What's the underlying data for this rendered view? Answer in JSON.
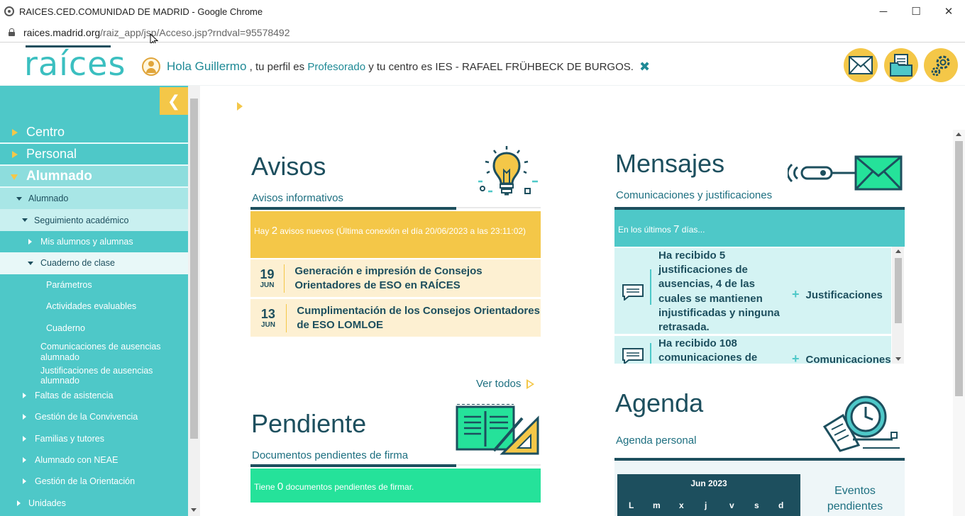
{
  "browser": {
    "window_title": "RAICES.CED.COMUNIDAD DE MADRID - Google Chrome",
    "url_host": "raices.madrid.org",
    "url_path": "/raiz_app/jsp/Acceso.jsp?rndval=95578492",
    "minimize": "─",
    "maximize": "☐",
    "close": "✕"
  },
  "header": {
    "logo": "raíces",
    "greeting_hola": "Hola Guillermo",
    "greeting_mid": ", tu perfil es",
    "perfil": "Profesorado",
    "greeting_centro": "y tu centro es IES - RAFAEL FRÜHBECK DE BURGOS.",
    "close_glyph": "✖",
    "buttons": [
      "mail-icon",
      "documents-icon",
      "settings-icon"
    ]
  },
  "sidebar": {
    "collapse_glyph": "❮",
    "items": [
      {
        "label": "Centro"
      },
      {
        "label": "Personal"
      },
      {
        "label": "Alumnado"
      },
      {
        "label": "Alumnado"
      },
      {
        "label": "Seguimiento académico"
      },
      {
        "label": "Mis alumnos y alumnas"
      },
      {
        "label": "Cuaderno de clase"
      },
      {
        "label": "Parámetros"
      },
      {
        "label": "Actividades evaluables"
      },
      {
        "label": "Cuaderno"
      },
      {
        "label": "Comunicaciones de ausencias alumnado"
      },
      {
        "label": "Justificaciones de ausencias alumnado"
      },
      {
        "label": "Faltas de asistencia"
      },
      {
        "label": "Gestión de la Convivencia"
      },
      {
        "label": "Familias y tutores"
      },
      {
        "label": "Alumnado con NEAE"
      },
      {
        "label": "Gestión de la Orientación"
      },
      {
        "label": "Unidades"
      }
    ]
  },
  "avisos": {
    "title": "Avisos",
    "subtitle": "Avisos informativos",
    "banner_pre": "Hay",
    "banner_num": "2",
    "banner_post": "avisos nuevos (Última conexión el día 20/06/2023 a las 23:11:02)",
    "items": [
      {
        "day": "19",
        "month": "JUN",
        "text": "Generación e impresión de Consejos Orientadores de ESO en RAÍCES"
      },
      {
        "day": "13",
        "month": "JUN",
        "text": "Cumplimentación de los Consejos Orientadores de ESO LOMLOE"
      }
    ],
    "ver_todos": "Ver todos"
  },
  "pendiente": {
    "title": "Pendiente",
    "subtitle": "Documentos pendientes de firma",
    "banner_pre": "Tiene",
    "banner_num": "0",
    "banner_post": "documentos pendientes de firmar."
  },
  "mensajes": {
    "title": "Mensajes",
    "subtitle": "Comunicaciones y justificaciones",
    "banner_pre": "En los últimos",
    "banner_num": "7",
    "banner_post": "días...",
    "items": [
      {
        "text": "Ha recibido 5 justificaciones de ausencias, 4 de las cuales se mantienen injustificadas y ninguna retrasada.",
        "plus": "+",
        "link": "Justificaciones"
      },
      {
        "text": "Ha recibido 108 comunicaciones de",
        "plus": "+",
        "link": "Comunicaciones"
      }
    ]
  },
  "agenda": {
    "title": "Agenda",
    "subtitle": "Agenda personal",
    "month": "Jun 2023",
    "weekdays": [
      "L",
      "m",
      "x",
      "j",
      "v",
      "s",
      "d"
    ],
    "eventos": "Eventos pendientes"
  },
  "colors": {
    "teal": "#4ec8c8",
    "dark": "#1d4f5e",
    "yellow": "#f4c748",
    "green": "#25e29a"
  }
}
